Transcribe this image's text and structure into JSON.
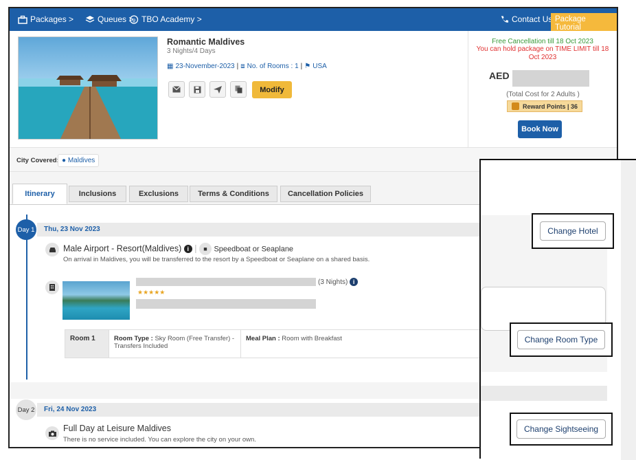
{
  "nav": {
    "packages": "Packages >",
    "queues": "Queues >",
    "academy": "TBO Academy >",
    "contact": "Contact Us",
    "tutorial": "Package Tutorial"
  },
  "package": {
    "name": "Romantic Maldives",
    "duration": "3 Nights/4 Days",
    "date": "23-November-2023",
    "rooms": "No. of Rooms : 1",
    "country": "USA",
    "modify_label": "Modify"
  },
  "price": {
    "free_cancellation": "Free Cancellation till 18 Oct 2023",
    "hold_notice": "You can hold package on TIME LIMIT till 18 Oct 2023",
    "currency": "AED",
    "total_note": "(Total Cost for 2 Adults )",
    "reward": "Reward Points | 36",
    "book_label": "Book Now"
  },
  "city": {
    "label": "City Covered:",
    "value": "Maldives"
  },
  "tabs": [
    "Itinerary",
    "Inclusions",
    "Exclusions",
    "Terms & Conditions",
    "Cancellation Policies"
  ],
  "days": [
    {
      "badge": "Day 1",
      "date": "Thu, 23 Nov 2023",
      "transfer_title": "Male Airport - Resort(Maldives)",
      "transfer_mode": "Speedboat or Seaplane",
      "transfer_desc": "On arrival in Maldives, you will be transferred to the resort by a Speedboat or Seaplane on a shared basis.",
      "hotel_nights": "(3 Nights)",
      "stars": "★★★★★",
      "room_label": "Room 1",
      "room_type_label": "Room Type :",
      "room_type": "Sky Room (Free Transfer) - Transfers Included",
      "meal_label": "Meal Plan :",
      "meal": "Room with Breakfast"
    },
    {
      "badge": "Day 2",
      "date": "Fri, 24 Nov 2023",
      "activity_title": "Full Day at Leisure Maldives",
      "activity_desc": "There is no service included. You can explore the city on your own."
    }
  ],
  "overlay": {
    "change_hotel": "Change Hotel",
    "change_room": "Change Room Type",
    "change_sightseeing": "Change Sightseeing"
  },
  "colors": {
    "primary": "#1d5fa8",
    "accent": "#f0b93a",
    "success": "#3a9a3a",
    "danger": "#e03030"
  }
}
